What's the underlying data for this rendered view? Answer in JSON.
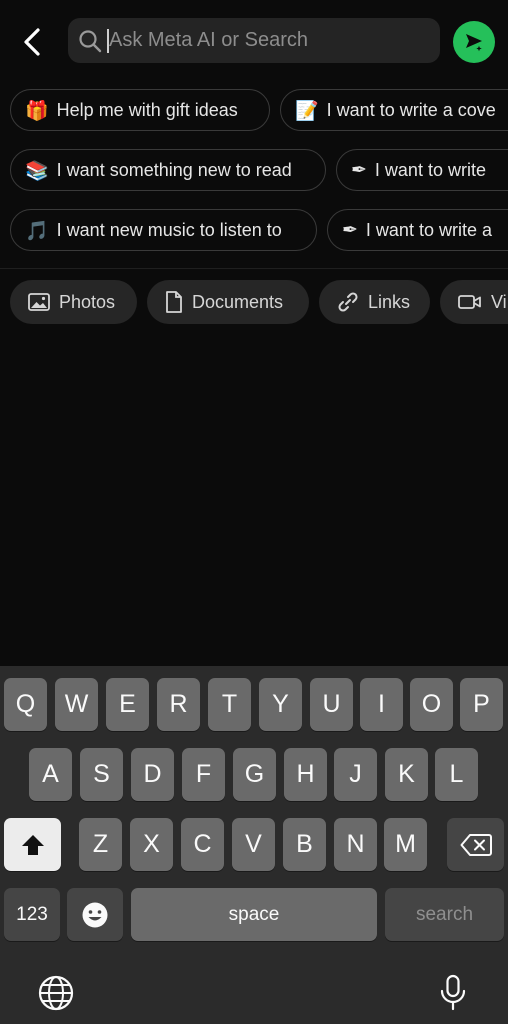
{
  "search": {
    "placeholder": "Ask Meta AI or Search",
    "value": ""
  },
  "suggestions": [
    {
      "emoji": "🎁",
      "label": "Help me with gift ideas"
    },
    {
      "emoji": "📝",
      "label": "I want to write a cove"
    },
    {
      "emoji": "📚",
      "label": "I want something new to read"
    },
    {
      "emoji": "✒",
      "label": "I want to write"
    },
    {
      "emoji": "🎵",
      "label": "I want new music to listen to"
    },
    {
      "emoji": "✒",
      "label": "I want to write a"
    }
  ],
  "filters": [
    "Photos",
    "Documents",
    "Links",
    "Vi"
  ],
  "keyboard": {
    "row1": [
      "Q",
      "W",
      "E",
      "R",
      "T",
      "Y",
      "U",
      "I",
      "O",
      "P"
    ],
    "row2": [
      "A",
      "S",
      "D",
      "F",
      "G",
      "H",
      "J",
      "K",
      "L"
    ],
    "row3": [
      "Z",
      "X",
      "C",
      "V",
      "B",
      "N",
      "M"
    ],
    "numbers_label": "123",
    "space_label": "space",
    "search_label": "search"
  },
  "colors": {
    "accent": "#25c05a",
    "background": "#0b0b0b",
    "keyboard": "#2b2b2b"
  }
}
